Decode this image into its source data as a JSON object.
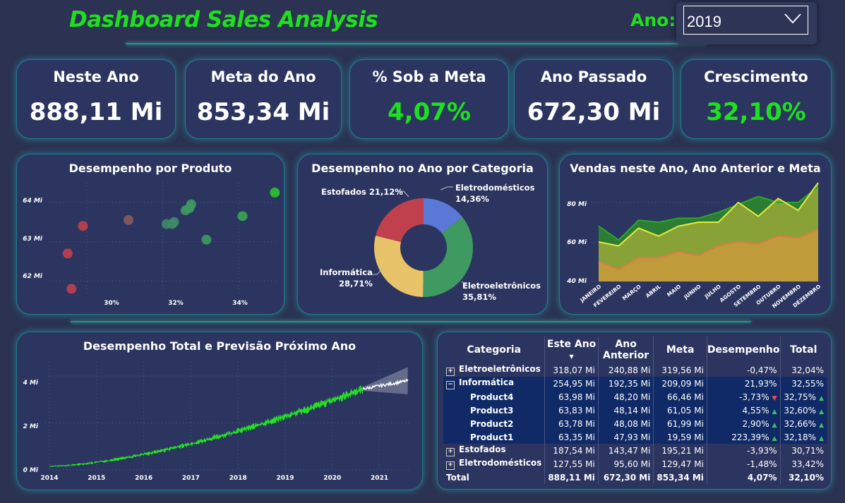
{
  "header": {
    "title": "Dashboard Sales Analysis",
    "year_label": "Ano:",
    "year_value": "2019"
  },
  "kpis": [
    {
      "label": "Neste Ano",
      "value": "888,11 Mi",
      "color": "#ffffff"
    },
    {
      "label": "Meta do Ano",
      "value": "853,34 Mi",
      "color": "#ffffff"
    },
    {
      "label": "% Sob a Meta",
      "value": "4,07%",
      "color": "#1ee01e"
    },
    {
      "label": "Ano Passado",
      "value": "672,30 Mi",
      "color": "#ffffff"
    },
    {
      "label": "Crescimento",
      "value": "32,10%",
      "color": "#1ee01e"
    }
  ],
  "scatter": {
    "title": "Desempenho por Produto",
    "y_ticks": [
      "62 Mi",
      "63 Mi",
      "64 Mi"
    ],
    "x_ticks": [
      "30%",
      "32%",
      "34%"
    ]
  },
  "donut": {
    "title": "Desempenho no Ano por Categoria",
    "labels": [
      {
        "name": "Estofados",
        "pct": "21,12%"
      },
      {
        "name": "Eletrodomésticos",
        "pct": "14,36%"
      },
      {
        "name": "Informática",
        "pct": "28,71%"
      },
      {
        "name": "Eletroeletrônicos",
        "pct": "35,81%"
      }
    ]
  },
  "area": {
    "title": "Vendas neste Ano, Ano Anterior e Meta",
    "y_ticks": [
      "40 Mi",
      "60 Mi",
      "80 Mi"
    ],
    "months": [
      "JANEIRO",
      "FEVEREIRO",
      "MARÇO",
      "ABRIL",
      "MAIO",
      "JUNHO",
      "JULHO",
      "AGOSTO",
      "SETEMBRO",
      "OUTUBRO",
      "NOVEMBRO",
      "DEZEMBRO"
    ]
  },
  "forecast": {
    "title": "Desempenho Total e Previsão Próximo Ano",
    "y_ticks": [
      "0 Mi",
      "2 Mi",
      "4 Mi"
    ],
    "x_ticks": [
      "2014",
      "2015",
      "2016",
      "2017",
      "2018",
      "2019",
      "2020",
      "2021"
    ]
  },
  "table": {
    "headers": {
      "category": "Categoria",
      "this_year": "Este Ano",
      "last_year": "Ano Anterior",
      "goal": "Meta",
      "performance": "Desempenho",
      "total": "Total"
    },
    "rows": [
      {
        "cat": "Eletroeletrônicos",
        "this_year": "318,07 Mi",
        "last_year": "240,88 Mi",
        "goal": "319,56 Mi",
        "perf": "-0,47%",
        "total": "32,04%"
      },
      {
        "cat": "Informática",
        "this_year": "254,95 Mi",
        "last_year": "192,35 Mi",
        "goal": "209,09 Mi",
        "perf": "21,93%",
        "total": "32,55%"
      },
      {
        "cat": "Product4",
        "this_year": "63,98 Mi",
        "last_year": "48,20 Mi",
        "goal": "66,46 Mi",
        "perf": "-3,73%",
        "total": "32,75%"
      },
      {
        "cat": "Product3",
        "this_year": "63,83 Mi",
        "last_year": "48,14 Mi",
        "goal": "61,05 Mi",
        "perf": "4,55%",
        "total": "32,60%"
      },
      {
        "cat": "Product2",
        "this_year": "63,78 Mi",
        "last_year": "48,08 Mi",
        "goal": "61,99 Mi",
        "perf": "2,90%",
        "total": "32,66%"
      },
      {
        "cat": "Product1",
        "this_year": "63,35 Mi",
        "last_year": "47,93 Mi",
        "goal": "19,59 Mi",
        "perf": "223,39%",
        "total": "32,18%"
      },
      {
        "cat": "Estofados",
        "this_year": "187,54 Mi",
        "last_year": "143,47 Mi",
        "goal": "195,21 Mi",
        "perf": "-3,93%",
        "total": "30,71%"
      },
      {
        "cat": "Eletrodomésticos",
        "this_year": "127,55 Mi",
        "last_year": "95,60 Mi",
        "goal": "129,47 Mi",
        "perf": "-1,48%",
        "total": "33,42%"
      },
      {
        "cat": "Total",
        "this_year": "888,11 Mi",
        "last_year": "672,30 Mi",
        "goal": "853,34 Mi",
        "perf": "4,07%",
        "total": "32,10%"
      }
    ]
  },
  "chart_data": [
    {
      "type": "scatter",
      "title": "Desempenho por Produto",
      "xlabel": "",
      "ylabel": "",
      "xlim": [
        29,
        35
      ],
      "ylim": [
        61.7,
        64.5
      ],
      "points": [
        {
          "x": 29.5,
          "y": 62.7,
          "color": "#c0404e"
        },
        {
          "x": 29.6,
          "y": 61.8,
          "color": "#c0404e"
        },
        {
          "x": 29.9,
          "y": 63.4,
          "color": "#c0404e"
        },
        {
          "x": 31.1,
          "y": 63.55,
          "color": "#8a5a5a"
        },
        {
          "x": 32.1,
          "y": 63.45,
          "color": "#3f8a66"
        },
        {
          "x": 32.25,
          "y": 63.45,
          "color": "#3f8a66"
        },
        {
          "x": 32.3,
          "y": 63.5,
          "color": "#3f8a66"
        },
        {
          "x": 32.6,
          "y": 63.8,
          "color": "#3e9a62"
        },
        {
          "x": 32.7,
          "y": 63.85,
          "color": "#3e9a62"
        },
        {
          "x": 32.75,
          "y": 63.95,
          "color": "#3e9a62"
        },
        {
          "x": 33.15,
          "y": 63.05,
          "color": "#3e9a62"
        },
        {
          "x": 34.1,
          "y": 63.65,
          "color": "#3aa852"
        },
        {
          "x": 34.95,
          "y": 64.25,
          "color": "#2fc42f"
        }
      ]
    },
    {
      "type": "pie",
      "title": "Desempenho no Ano por Categoria",
      "categories": [
        "Eletrodomésticos",
        "Eletroeletrônicos",
        "Informática",
        "Estofados"
      ],
      "values": [
        14.36,
        35.81,
        28.71,
        21.12
      ],
      "colors": [
        "#5a78d6",
        "#3f9a62",
        "#e8c36a",
        "#c0404e"
      ]
    },
    {
      "type": "area",
      "title": "Vendas neste Ano, Ano Anterior e Meta",
      "categories": [
        "JANEIRO",
        "FEVEREIRO",
        "MARÇO",
        "ABRIL",
        "MAIO",
        "JUNHO",
        "JULHO",
        "AGOSTO",
        "SETEMBRO",
        "OUTUBRO",
        "NOVEMBRO",
        "DEZEMBRO"
      ],
      "ylim": [
        40,
        90
      ],
      "series": [
        {
          "values": [
            68,
            61,
            71,
            70,
            72,
            72,
            75,
            79,
            83,
            80,
            80,
            88
          ],
          "color": "#2aa82a"
        },
        {
          "values": [
            60,
            58,
            67,
            63,
            68,
            70,
            70,
            80,
            73,
            82,
            76,
            90
          ],
          "color": "#e8e83a"
        },
        {
          "values": [
            50,
            46,
            52,
            52,
            55,
            53,
            58,
            60,
            59,
            63,
            62,
            66
          ],
          "color": "#e07a4a"
        }
      ]
    },
    {
      "type": "line",
      "title": "Desempenho Total e Previsão Próximo Ano",
      "xlim": [
        2014,
        2021.65
      ],
      "ylim": [
        0,
        4.6
      ],
      "series": [
        {
          "kind": "actual",
          "start": 2014,
          "end": 2020.65,
          "y_start": 0.15,
          "y_end": 3.45,
          "color": "#22e022"
        },
        {
          "kind": "forecast",
          "start": 2020.65,
          "end": 2021.6,
          "y_start": 3.45,
          "y_end": 3.8,
          "color": "#ffffff",
          "band_color": "#8a8fa8"
        }
      ]
    }
  ]
}
